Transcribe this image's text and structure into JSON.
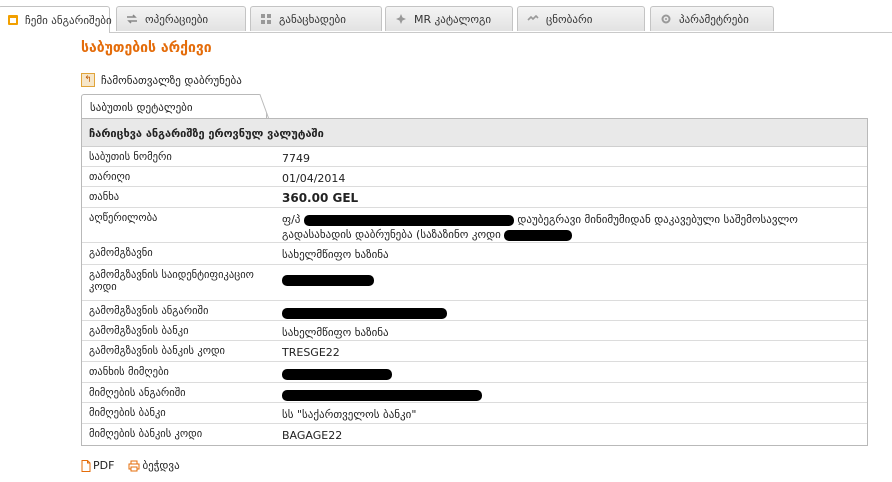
{
  "tabs": [
    {
      "label": "ჩემი ანგარიშები",
      "icon": "my-accounts-icon",
      "active": true
    },
    {
      "label": "ოპერაციები",
      "icon": "transfer-arrows-icon"
    },
    {
      "label": "განაცხადები",
      "icon": "grid-icon"
    },
    {
      "label": "MR კატალოგი",
      "icon": "catalog-icon"
    },
    {
      "label": "ცნობარი",
      "icon": "handshake-icon"
    },
    {
      "label": "პარამეტრები",
      "icon": "gear-icon"
    }
  ],
  "page": {
    "title": "საბუთების არქივი",
    "back_label": "ჩამონათვალზე დაბრუნება"
  },
  "panel": {
    "tab_label": "საბუთის დეტალები",
    "header": "ჩარიცხვა ანგარიშზე ეროვნულ ვალუტაში",
    "rows": [
      {
        "key": "საბუთის ნომერი",
        "value": "7749"
      },
      {
        "key": "თარიღი",
        "value": "01/04/2014"
      },
      {
        "key": "თანხა",
        "value": "360.00 GEL"
      },
      {
        "key": "აღწერილობა",
        "value_prefix": "ფ/პ",
        "value_mid": "დაუბეგრავი მინიმუმიდან დაკავებული საშემოსავლო",
        "value_line2": "გადასახადის დაბრუნება (საზაზინო კოდი"
      },
      {
        "key": "გამომგზავნი",
        "value": "სახელმწიფო ხაზინა"
      },
      {
        "key": "გამომგზავნის საიდენტიფიკაციო კოდი",
        "value": ""
      },
      {
        "key": "გამომგზავნის ანგარიში",
        "value": ""
      },
      {
        "key": "გამომგზავნის ბანკი",
        "value": "სახელმწიფო ხაზინა"
      },
      {
        "key": "გამომგზავნის ბანკის კოდი",
        "value": "TRESGE22"
      },
      {
        "key": "თანხის მიმღები",
        "value": ""
      },
      {
        "key": "მიმღების ანგარიში",
        "value": ""
      },
      {
        "key": "მიმღების ბანკი",
        "value": "სს \"საქართველოს ბანკი\""
      },
      {
        "key": "მიმღების ბანკის კოდი",
        "value": "BAGAGE22"
      }
    ]
  },
  "actions": {
    "pdf": "PDF",
    "print": "ბეჭდვა"
  },
  "colors": {
    "accent": "#e46c0a"
  }
}
